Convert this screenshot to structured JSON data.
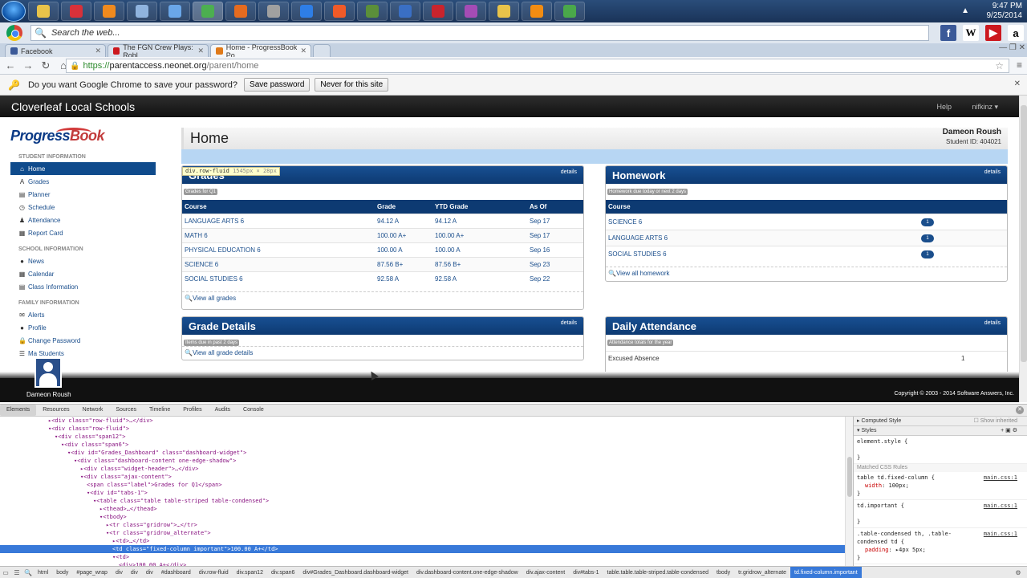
{
  "taskbar": {
    "icons": [
      {
        "name": "explorer",
        "color": "#e8c34a"
      },
      {
        "name": "roblox",
        "color": "#d8313a"
      },
      {
        "name": "media",
        "color": "#f08a1e"
      },
      {
        "name": "documents",
        "color": "#8fb3de"
      },
      {
        "name": "window",
        "color": "#6aa6e8"
      },
      {
        "name": "chrome",
        "color": "#4caf50",
        "active": true
      },
      {
        "name": "firefox",
        "color": "#e56b1f"
      },
      {
        "name": "tool",
        "color": "#a0a0a0"
      },
      {
        "name": "ie",
        "color": "#2e7ee6"
      },
      {
        "name": "firefox2",
        "color": "#f05a28"
      },
      {
        "name": "minecraft",
        "color": "#5b8f3a"
      },
      {
        "name": "m-app",
        "color": "#3a6fc4"
      },
      {
        "name": "roblox2",
        "color": "#c9242d"
      },
      {
        "name": "app",
        "color": "#a44cb5"
      },
      {
        "name": "shield",
        "color": "#e8c34a"
      },
      {
        "name": "orange",
        "color": "#f28c12"
      },
      {
        "name": "green",
        "color": "#4aa84a"
      }
    ],
    "time": "9:47 PM",
    "date": "9/25/2014"
  },
  "search_bar": {
    "placeholder": "Search the web..."
  },
  "tabs": [
    {
      "label": "Facebook",
      "color": "#3b5998"
    },
    {
      "label": "The FGN Crew Plays: Robl",
      "color": "#cc181e"
    },
    {
      "label": "Home - ProgressBook Po",
      "color": "#e07a1a",
      "active": true
    }
  ],
  "address": {
    "scheme": "https://",
    "host": "parentaccess.neonet.org",
    "path": "/parent/home"
  },
  "password_bar": {
    "question": "Do you want Google Chrome to save your password?",
    "save": "Save password",
    "never": "Never for this site"
  },
  "site": {
    "name": "Cloverleaf Local Schools",
    "help": "Help",
    "user_menu": "nifkinz ▾",
    "logo_a": "Progress",
    "logo_b": "Book"
  },
  "sidebar": {
    "student_head": "STUDENT INFORMATION",
    "student_items": [
      {
        "icon": "⌂",
        "label": "Home",
        "active": true
      },
      {
        "icon": "A",
        "label": "Grades"
      },
      {
        "icon": "▤",
        "label": "Planner"
      },
      {
        "icon": "◷",
        "label": "Schedule"
      },
      {
        "icon": "♟",
        "label": "Attendance"
      },
      {
        "icon": "▦",
        "label": "Report Card"
      }
    ],
    "school_head": "SCHOOL INFORMATION",
    "school_items": [
      {
        "icon": "●",
        "label": "News"
      },
      {
        "icon": "▦",
        "label": "Calendar"
      },
      {
        "icon": "▤",
        "label": "Class Information"
      }
    ],
    "family_head": "FAMILY INFORMATION",
    "family_items": [
      {
        "icon": "✉",
        "label": "Alerts"
      },
      {
        "icon": "●",
        "label": "Profile"
      },
      {
        "icon": "🔒",
        "label": "Change Password"
      },
      {
        "icon": "☰",
        "label": "Ma        Students"
      }
    ]
  },
  "student": {
    "name": "Dameon Roush",
    "id_line": "Student ID: 404021",
    "footer_name": "Dameon Roush"
  },
  "page_title": "Home",
  "tooltip": {
    "selector": "div.row-fluid",
    "dims": "1545px × 28px"
  },
  "widgets": {
    "grades": {
      "title": "Grades",
      "details": "details",
      "label": "Grades for Q1",
      "headers": [
        "Course",
        "Grade",
        "YTD Grade",
        "As Of"
      ],
      "rows": [
        [
          "LANGUAGE ARTS 6",
          "94.12 A",
          "94.12 A",
          "Sep 17"
        ],
        [
          "MATH 6",
          "100.00 A+",
          "100.00 A+",
          "Sep 17"
        ],
        [
          "PHYSICAL EDUCATION 6",
          "100.00 A",
          "100.00 A",
          "Sep 16"
        ],
        [
          "SCIENCE 6",
          "87.56 B+",
          "87.56 B+",
          "Sep 23"
        ],
        [
          "SOCIAL STUDIES 6",
          "92.58 A",
          "92.58 A",
          "Sep 22"
        ]
      ],
      "footer": "View all grades"
    },
    "homework": {
      "title": "Homework",
      "details": "details",
      "label": "Homework due today or next 2 days",
      "headers": [
        "Course"
      ],
      "rows": [
        [
          "SCIENCE 6",
          "1"
        ],
        [
          "LANGUAGE ARTS 6",
          "1"
        ],
        [
          "SOCIAL STUDIES 6",
          "1"
        ]
      ],
      "footer": "View all homework"
    },
    "grade_details": {
      "title": "Grade Details",
      "details": "details",
      "label": "Items due in past 2 days",
      "footer": "View all grade details"
    },
    "attendance": {
      "title": "Daily Attendance",
      "details": "details",
      "label": "Attendance totals for the year",
      "rows": [
        [
          "Excused Absence",
          "1"
        ]
      ]
    }
  },
  "copyright": "Copyright © 2003 - 2014 Software Answers, Inc.",
  "devtools": {
    "tabs": [
      "Elements",
      "Resources",
      "Network",
      "Sources",
      "Timeline",
      "Profiles",
      "Audits",
      "Console"
    ],
    "dom_lines": [
      {
        "indent": 7,
        "text": "▸<div class=\"row-fluid\">…</div>"
      },
      {
        "indent": 7,
        "text": "▾<div class=\"row-fluid\">"
      },
      {
        "indent": 8,
        "text": "▾<div class=\"span12\">"
      },
      {
        "indent": 9,
        "text": "▾<div class=\"span6\">"
      },
      {
        "indent": 10,
        "text": "▾<div id=\"Grades_Dashboard\" class=\"dashboard-widget\">"
      },
      {
        "indent": 11,
        "text": "▾<div class=\"dashboard-content one-edge-shadow\">"
      },
      {
        "indent": 12,
        "text": "▸<div class=\"widget-header\">…</div>"
      },
      {
        "indent": 12,
        "text": "▾<div class=\"ajax-content\">"
      },
      {
        "indent": 13,
        "text": "<span class=\"label\">Grades for Q1</span>"
      },
      {
        "indent": 13,
        "text": "▾<div id=\"tabs-1\">"
      },
      {
        "indent": 14,
        "text": "▾<table class=\"table table-striped table-condensed\">"
      },
      {
        "indent": 15,
        "text": "▸<thead>…</thead>"
      },
      {
        "indent": 15,
        "text": "▾<tbody>"
      },
      {
        "indent": 16,
        "text": "▸<tr class=\"gridrow\">…</tr>"
      },
      {
        "indent": 16,
        "text": "▾<tr class=\"gridrow_alternate\">"
      },
      {
        "indent": 17,
        "text": "▸<td>…</td>"
      },
      {
        "indent": 17,
        "text": "<td class=\"fixed-column important\">100.00 A+</td>",
        "selected": true
      },
      {
        "indent": 17,
        "text": "▾<td>"
      },
      {
        "indent": 18,
        "text": "<div>100.00 A+</div>"
      }
    ],
    "styles": {
      "computed": "Computed Style",
      "show_inherited": "Show inherited",
      "styles_head": "Styles",
      "element_style": "element.style {",
      "close": "}",
      "matched": "Matched CSS Rules",
      "rule1_sel": "table td.fixed-column {",
      "rule1_src": "main.css:1",
      "rule1_prop": "width",
      "rule1_val": ": 100px;",
      "rule2_sel": "td.important {",
      "rule2_src": "main.css:1",
      "rule3_sel": ".table-condensed th, .table-condensed td {",
      "rule3_src": "main.css:1",
      "rule3_prop": "padding",
      "rule3_val": ": ▸4px 5px;"
    },
    "breadcrumbs": [
      "html",
      "body",
      "#page_wrap",
      "div",
      "div",
      "div",
      "#dashboard",
      "div.row-fluid",
      "div.span12",
      "div.span6",
      "div#Grades_Dashboard.dashboard-widget",
      "div.dashboard-content.one-edge-shadow",
      "div.ajax-content",
      "div#tabs-1",
      "table.table.table-striped.table-condensed",
      "tbody",
      "tr.gridrow_alternate",
      "td.fixed-column.important"
    ]
  }
}
